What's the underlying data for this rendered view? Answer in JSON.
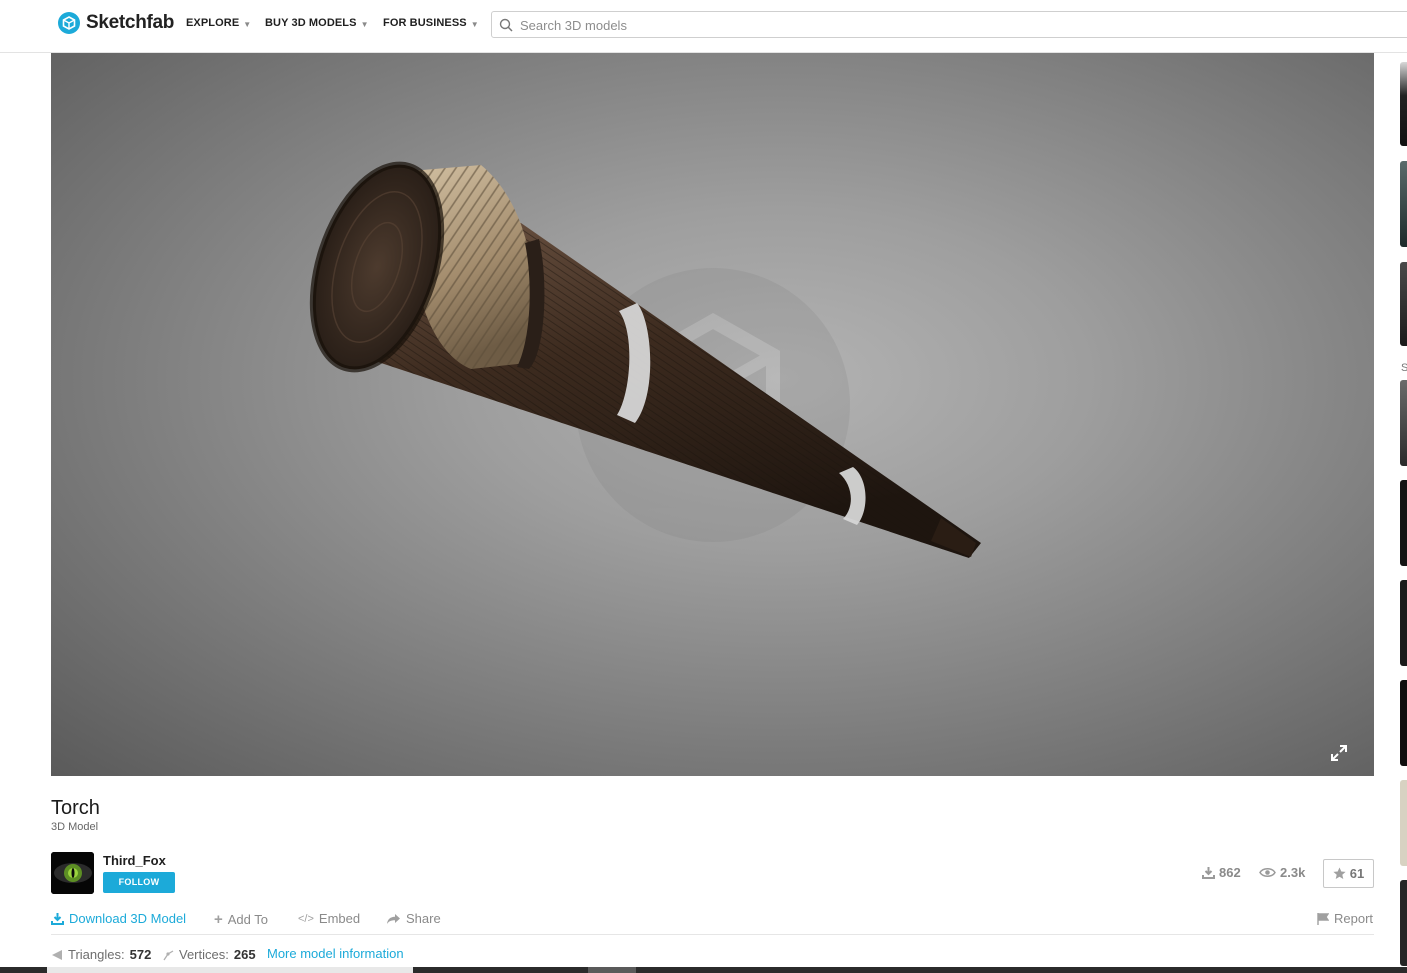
{
  "header": {
    "logo_text": "Sketchfab",
    "nav": [
      {
        "label": "EXPLORE"
      },
      {
        "label": "BUY 3D MODELS"
      },
      {
        "label": "FOR BUSINESS"
      }
    ],
    "search_placeholder": "Search 3D models"
  },
  "model": {
    "title": "Torch",
    "type_label": "3D Model"
  },
  "author": {
    "name": "Third_Fox",
    "follow_label": "FOLLOW"
  },
  "stats": {
    "downloads": "862",
    "views": "2.3k",
    "likes": "61"
  },
  "actions": {
    "download": "Download 3D Model",
    "add_to": "Add To",
    "embed": "Embed",
    "share": "Share",
    "report": "Report"
  },
  "model_info": {
    "triangles_label": "Triangles:",
    "triangles_value": "572",
    "vertices_label": "Vertices:",
    "vertices_value": "265",
    "more_link": "More model information"
  },
  "sidebar": {
    "partial_letter": "S"
  },
  "colors": {
    "accent": "#1caad9",
    "viewer_bg": "#8f8f8f",
    "wood": "#4a3527",
    "rope": "#b7a184"
  },
  "icons": [
    "sketchfab-logo-icon",
    "search-icon",
    "fullscreen-icon",
    "download-icon",
    "eye-icon",
    "star-icon",
    "plus-icon",
    "code-icon",
    "share-icon",
    "flag-icon",
    "triangle-icon",
    "vertex-icon"
  ]
}
